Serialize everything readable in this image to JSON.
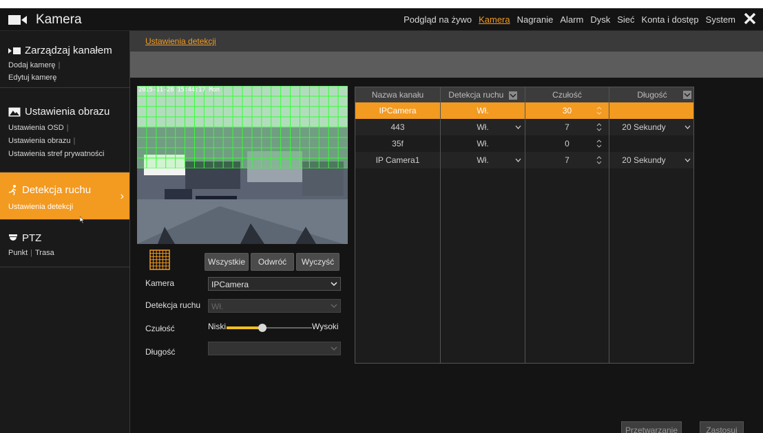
{
  "app": {
    "title": "Kamera"
  },
  "nav": {
    "items": [
      "Podgląd na żywo",
      "Kamera",
      "Nagranie",
      "Alarm",
      "Dysk",
      "Sieć",
      "Konta i dostęp",
      "System"
    ],
    "active": "Kamera"
  },
  "sidebar": {
    "groups": [
      {
        "title": "Zarządzaj kanałem",
        "icon": "channel-icon",
        "subs": [
          "Dodaj kamerę",
          "Edytuj kamerę"
        ]
      },
      {
        "title": "Ustawienia obrazu",
        "icon": "image-icon",
        "subs": [
          "Ustawienia OSD",
          "Ustawienia obrazu",
          "Ustawienia stref prywatności"
        ]
      },
      {
        "title": "Detekcja ruchu",
        "icon": "running-man-icon",
        "subs": [
          "Ustawienia detekcji"
        ],
        "active": true
      },
      {
        "title": "PTZ",
        "icon": "ptz-dome-icon",
        "subs": [
          "Punkt",
          "Trasa"
        ]
      }
    ]
  },
  "breadcrumb": "Ustawienia detekcji",
  "preview": {
    "osd_text": "2015-11-28 15:44:17 Mon"
  },
  "grid_buttons": {
    "all": "Wszystkie",
    "invert": "Odwróć",
    "clear": "Wyczyść"
  },
  "form": {
    "camera_label": "Kamera",
    "camera_value": "IPCamera",
    "motion_label": "Detekcja ruchu",
    "motion_value": "Wł.",
    "sensitivity_label": "Czułość",
    "sensitivity_low": "Niski",
    "sensitivity_high": "Wysoki",
    "sensitivity_value": 0.42,
    "duration_label": "Długość",
    "duration_value": ""
  },
  "table": {
    "headers": [
      "Nazwa kanału",
      "Detekcja ruchu",
      "Czułość",
      "Długość"
    ],
    "rows": [
      {
        "name": "IPCamera",
        "motion": "Wł.",
        "sensitivity": "30",
        "duration": "",
        "selected": true
      },
      {
        "name": "443",
        "motion": "Wł.",
        "sensitivity": "7",
        "duration": "20 Sekundy"
      },
      {
        "name": "35f",
        "motion": "Wł.",
        "sensitivity": "0",
        "duration": ""
      },
      {
        "name": "IP Camera1",
        "motion": "Wł.",
        "sensitivity": "7",
        "duration": "20 Sekundy"
      }
    ]
  },
  "footer": {
    "process": "Przetwarzanie",
    "apply": "Zastosuj"
  },
  "colors": {
    "accent": "#f39a21",
    "grid": "#33ff33",
    "slider": "#f3c01b"
  }
}
